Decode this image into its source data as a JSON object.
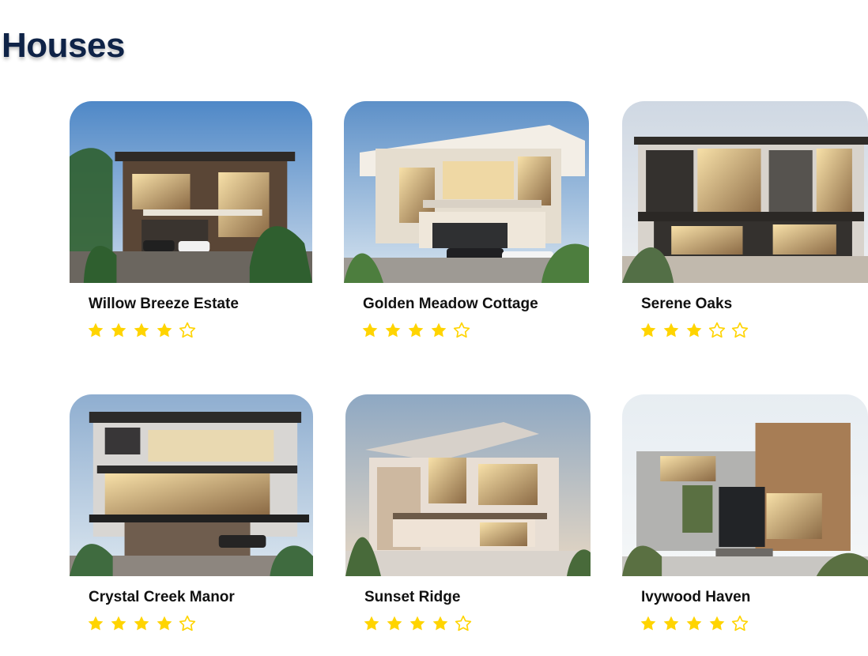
{
  "page": {
    "title": "Houses"
  },
  "houses": [
    {
      "name": "Willow Breeze Estate",
      "rating": 4,
      "max_rating": 5,
      "sky_top": "#4f88c7",
      "sky_bottom": "#c9d9ea",
      "wall": "#5a4636",
      "accent": "#e9e3d7",
      "greenery": "#2f5f2f"
    },
    {
      "name": "Golden Meadow Cottage",
      "rating": 4,
      "max_rating": 5,
      "sky_top": "#5d90c8",
      "sky_bottom": "#d7e4ef",
      "wall": "#e5ddcf",
      "accent": "#f1d79c",
      "greenery": "#4d7e3e"
    },
    {
      "name": "Serene Oaks",
      "rating": 3,
      "max_rating": 5,
      "sky_top": "#cfd8e3",
      "sky_bottom": "#eef0f2",
      "wall": "#34312e",
      "accent": "#f3e3b6",
      "greenery": "#536f46"
    },
    {
      "name": "Crystal Creek Manor",
      "rating": 4,
      "max_rating": 5,
      "sky_top": "#8faed0",
      "sky_bottom": "#dbe6ef",
      "wall": "#383637",
      "accent": "#f4dfb1",
      "greenery": "#3f6b3f"
    },
    {
      "name": "Sunset Ridge",
      "rating": 4,
      "max_rating": 5,
      "sky_top": "#8ea8c3",
      "sky_bottom": "#e8d8c3",
      "wall": "#e8ded4",
      "accent": "#f0c179",
      "greenery": "#486a3a"
    },
    {
      "name": "Ivywood Haven",
      "rating": 4,
      "max_rating": 5,
      "sky_top": "#e7edf2",
      "sky_bottom": "#f5f7f8",
      "wall": "#b2b2b0",
      "accent": "#a77d55",
      "greenery": "#5a7042"
    }
  ],
  "ui": {
    "star_fill_color": "#ffd400",
    "star_outline_color": "#ffd400"
  }
}
